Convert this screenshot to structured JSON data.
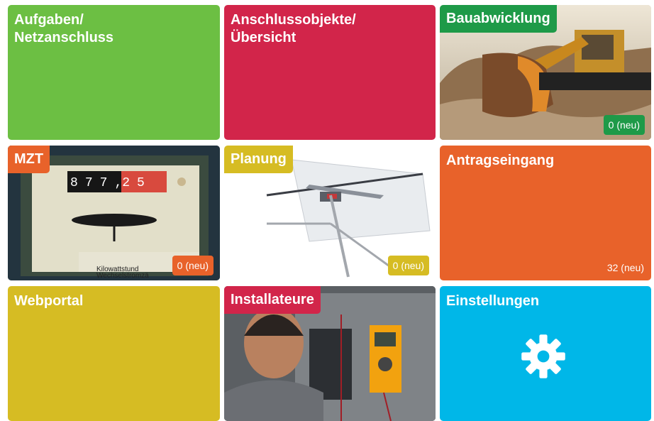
{
  "colors": {
    "green": "#6cbf43",
    "red": "#d2254a",
    "orange": "#e8622a",
    "yellow": "#d6bc23",
    "cyan": "#00b7e8",
    "dark_green": "#1e9a48"
  },
  "tiles": [
    {
      "title_line1": "Aufgaben/",
      "title_line2": "Netzanschluss"
    },
    {
      "title_line1": "Anschlussobjekte/",
      "title_line2": "Übersicht"
    },
    {
      "title": "Bauabwicklung",
      "badge": "0 (neu)",
      "image": "excavator-photo"
    },
    {
      "title": "MZT",
      "badge": "0 (neu)",
      "image": "electricity-meter-photo",
      "meter_digits": [
        "8",
        "7",
        "7",
        ",2",
        "5"
      ],
      "meter_label1": "Kilowattstund",
      "meter_label2": "Wechselstromzä"
    },
    {
      "title": "Planung",
      "badge": "0 (neu)",
      "image": "drafting-board-photo"
    },
    {
      "title": "Antragseingang",
      "count": "32 (neu)"
    },
    {
      "title": "Webportal"
    },
    {
      "title": "Installateure",
      "image": "technician-photo"
    },
    {
      "title": "Einstellungen",
      "icon": "gear-icon"
    }
  ]
}
